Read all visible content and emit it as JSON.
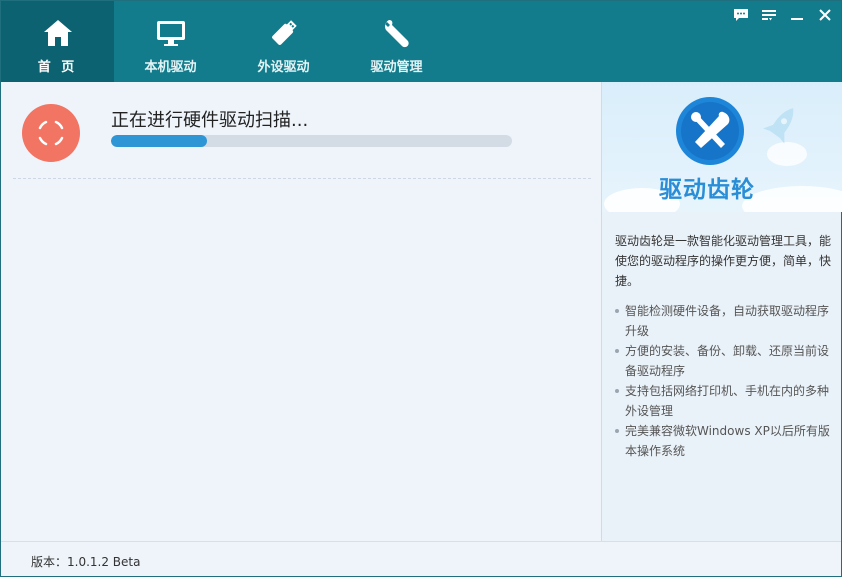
{
  "nav": {
    "tabs": [
      {
        "label": "首 页",
        "icon": "home-icon",
        "active": true
      },
      {
        "label": "本机驱动",
        "icon": "monitor-icon",
        "active": false
      },
      {
        "label": "外设驱动",
        "icon": "usb-drive-icon",
        "active": false
      },
      {
        "label": "驱动管理",
        "icon": "wrench-icon",
        "active": false
      }
    ]
  },
  "window_controls": [
    "feedback-icon",
    "menu-icon",
    "minimize-icon",
    "close-icon"
  ],
  "scan": {
    "status": "正在进行硬件驱动扫描...",
    "progress": 0.24
  },
  "sidebar": {
    "brand": "驱动齿轮",
    "intro": "驱动齿轮是一款智能化驱动管理工具，能使您的驱动程序的操作更方便，简单，快捷。",
    "features": [
      "智能检测硬件设备，自动获取驱动程序升级",
      "方便的安装、备份、卸载、还原当前设备驱动程序",
      "支持包括网络打印机、手机在内的多种外设管理",
      "完美兼容微软Windows XP以后所有版本操作系统"
    ]
  },
  "footer": {
    "version": "版本：1.0.1.2 Beta"
  },
  "colors": {
    "header": "#127c8c",
    "active_tab": "#0c6270",
    "scan_icon": "#f27463",
    "progress": "#2e96d5",
    "brand": "#2a8ed6"
  }
}
